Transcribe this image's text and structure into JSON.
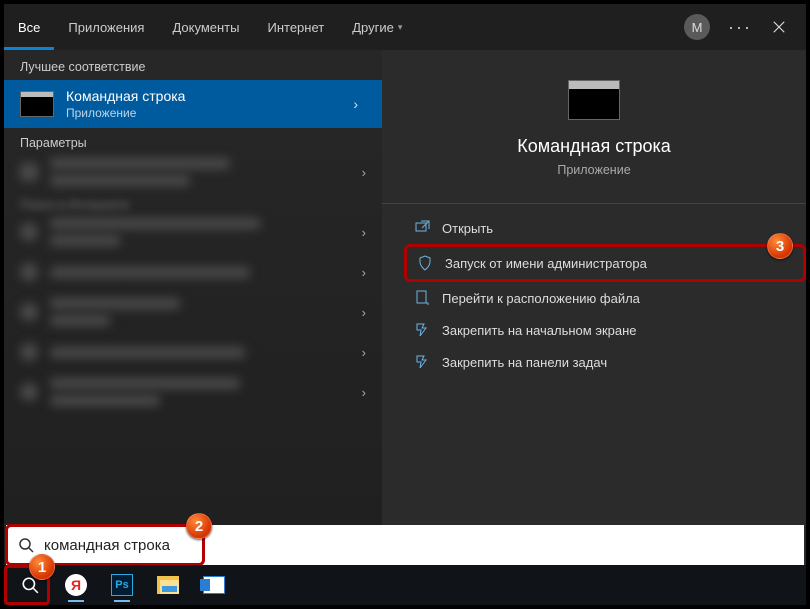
{
  "tabs": {
    "all": "Все",
    "apps": "Приложения",
    "docs": "Документы",
    "internet": "Интернет",
    "other": "Другие"
  },
  "avatarLetter": "М",
  "sections": {
    "bestMatch": "Лучшее соответствие",
    "parameters": "Параметры"
  },
  "bestMatch": {
    "title": "Командная строка",
    "subtitle": "Приложение"
  },
  "preview": {
    "title": "Командная строка",
    "subtitle": "Приложение"
  },
  "actions": {
    "open": "Открыть",
    "runAsAdmin": "Запуск от имени администратора",
    "openFileLocation": "Перейти к расположению файла",
    "pinToStart": "Закрепить на начальном экране",
    "pinToTaskbar": "Закрепить на панели задач"
  },
  "search": {
    "value": "командная строка"
  },
  "badges": {
    "b1": "1",
    "b2": "2",
    "b3": "3"
  }
}
